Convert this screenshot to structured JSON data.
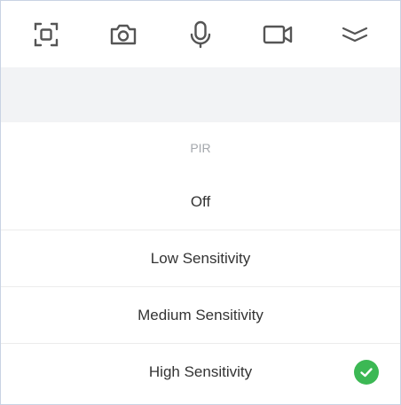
{
  "toolbar": {
    "items": [
      {
        "icon": "screenshot-icon"
      },
      {
        "icon": "camera-icon"
      },
      {
        "icon": "microphone-icon"
      },
      {
        "icon": "video-camera-icon"
      },
      {
        "icon": "collapse-chevron-icon"
      }
    ]
  },
  "sheet": {
    "title": "PIR",
    "options": [
      {
        "label": "Off",
        "selected": false
      },
      {
        "label": "Low Sensitivity",
        "selected": false
      },
      {
        "label": "Medium Sensitivity",
        "selected": false
      },
      {
        "label": "High Sensitivity",
        "selected": true
      }
    ],
    "check_color": "#3cb854"
  }
}
